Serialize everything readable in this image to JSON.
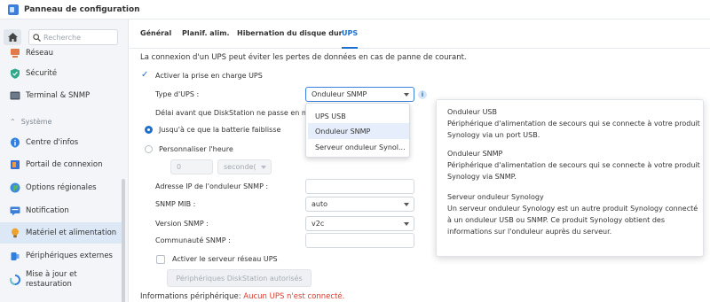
{
  "window": {
    "title": "Panneau de configuration"
  },
  "search": {
    "placeholder": "Recherche",
    "value": ""
  },
  "sidebar": {
    "items": [
      {
        "label": "Réseau",
        "icon": "network-icon"
      },
      {
        "label": "Sécurité",
        "icon": "shield-icon"
      },
      {
        "label": "Terminal & SNMP",
        "icon": "terminal-icon"
      }
    ],
    "section_label": "Système",
    "system_items": [
      {
        "label": "Centre d'infos",
        "icon": "info-icon"
      },
      {
        "label": "Portail de connexion",
        "icon": "login-portal-icon"
      },
      {
        "label": "Options régionales",
        "icon": "globe-icon"
      },
      {
        "label": "Notification",
        "icon": "chat-icon"
      },
      {
        "label": "Matériel et alimentation",
        "icon": "bulb-icon",
        "active": true
      },
      {
        "label": "Périphériques externes",
        "icon": "usb-icon"
      },
      {
        "label": "Mise à jour et\nrestauration",
        "icon": "update-icon"
      }
    ]
  },
  "tabs": [
    {
      "label": "Général",
      "active": false
    },
    {
      "label": "Planif. alim.",
      "active": false
    },
    {
      "label": "Hibernation du disque dur",
      "active": false
    },
    {
      "label": "UPS",
      "active": true
    }
  ],
  "ups": {
    "description": "La connexion d'un UPS peut éviter les pertes de données en cas de panne de courant.",
    "enable_label": "Activer la prise en charge UPS",
    "enable_checked": true,
    "type_label": "Type d'UPS :",
    "type_value": "Onduleur SNMP",
    "delay_label": "Délai avant que DiskStation ne passe en m",
    "radio_battery": "Jusqu'à ce que la batterie faiblisse",
    "radio_custom": "Personnaliser l'heure",
    "time_value": "0",
    "time_unit": "seconde(",
    "ip_label": "Adresse IP de l'onduleur SNMP :",
    "ip_value": "",
    "mib_label": "SNMP MIB :",
    "mib_value": "auto",
    "version_label": "Version SNMP :",
    "version_value": "v2c",
    "community_label": "Communauté SNMP :",
    "community_value": "",
    "server_label": "Activer le serveur réseau UPS",
    "server_button": "Périphériques DiskStation autorisés",
    "status_prefix": "Informations périphérique:",
    "status_value": "Aucun UPS n'est connecté."
  },
  "dropdown_options": [
    "UPS USB",
    "Onduleur SNMP",
    "Serveur onduleur Synol..."
  ],
  "tooltip": {
    "usb_title": "Onduleur USB",
    "usb_text": "Périphérique d'alimentation de secours qui se connecte à votre produit Synology via un port USB.",
    "snmp_title": "Onduleur SNMP",
    "snmp_text": "Périphérique d'alimentation de secours qui se connecte à votre produit Synology via SNMP.",
    "server_title": "Serveur onduleur Synology",
    "server_text": "Un serveur onduleur Synology est un autre produit Synology connecté à un onduleur USB ou SNMP. Ce produit Synology obtient des informations sur l'onduleur auprès du serveur."
  },
  "colors": {
    "accent": "#1f6fd1",
    "error": "#d93a2b",
    "active_bg": "#dde8f7"
  }
}
